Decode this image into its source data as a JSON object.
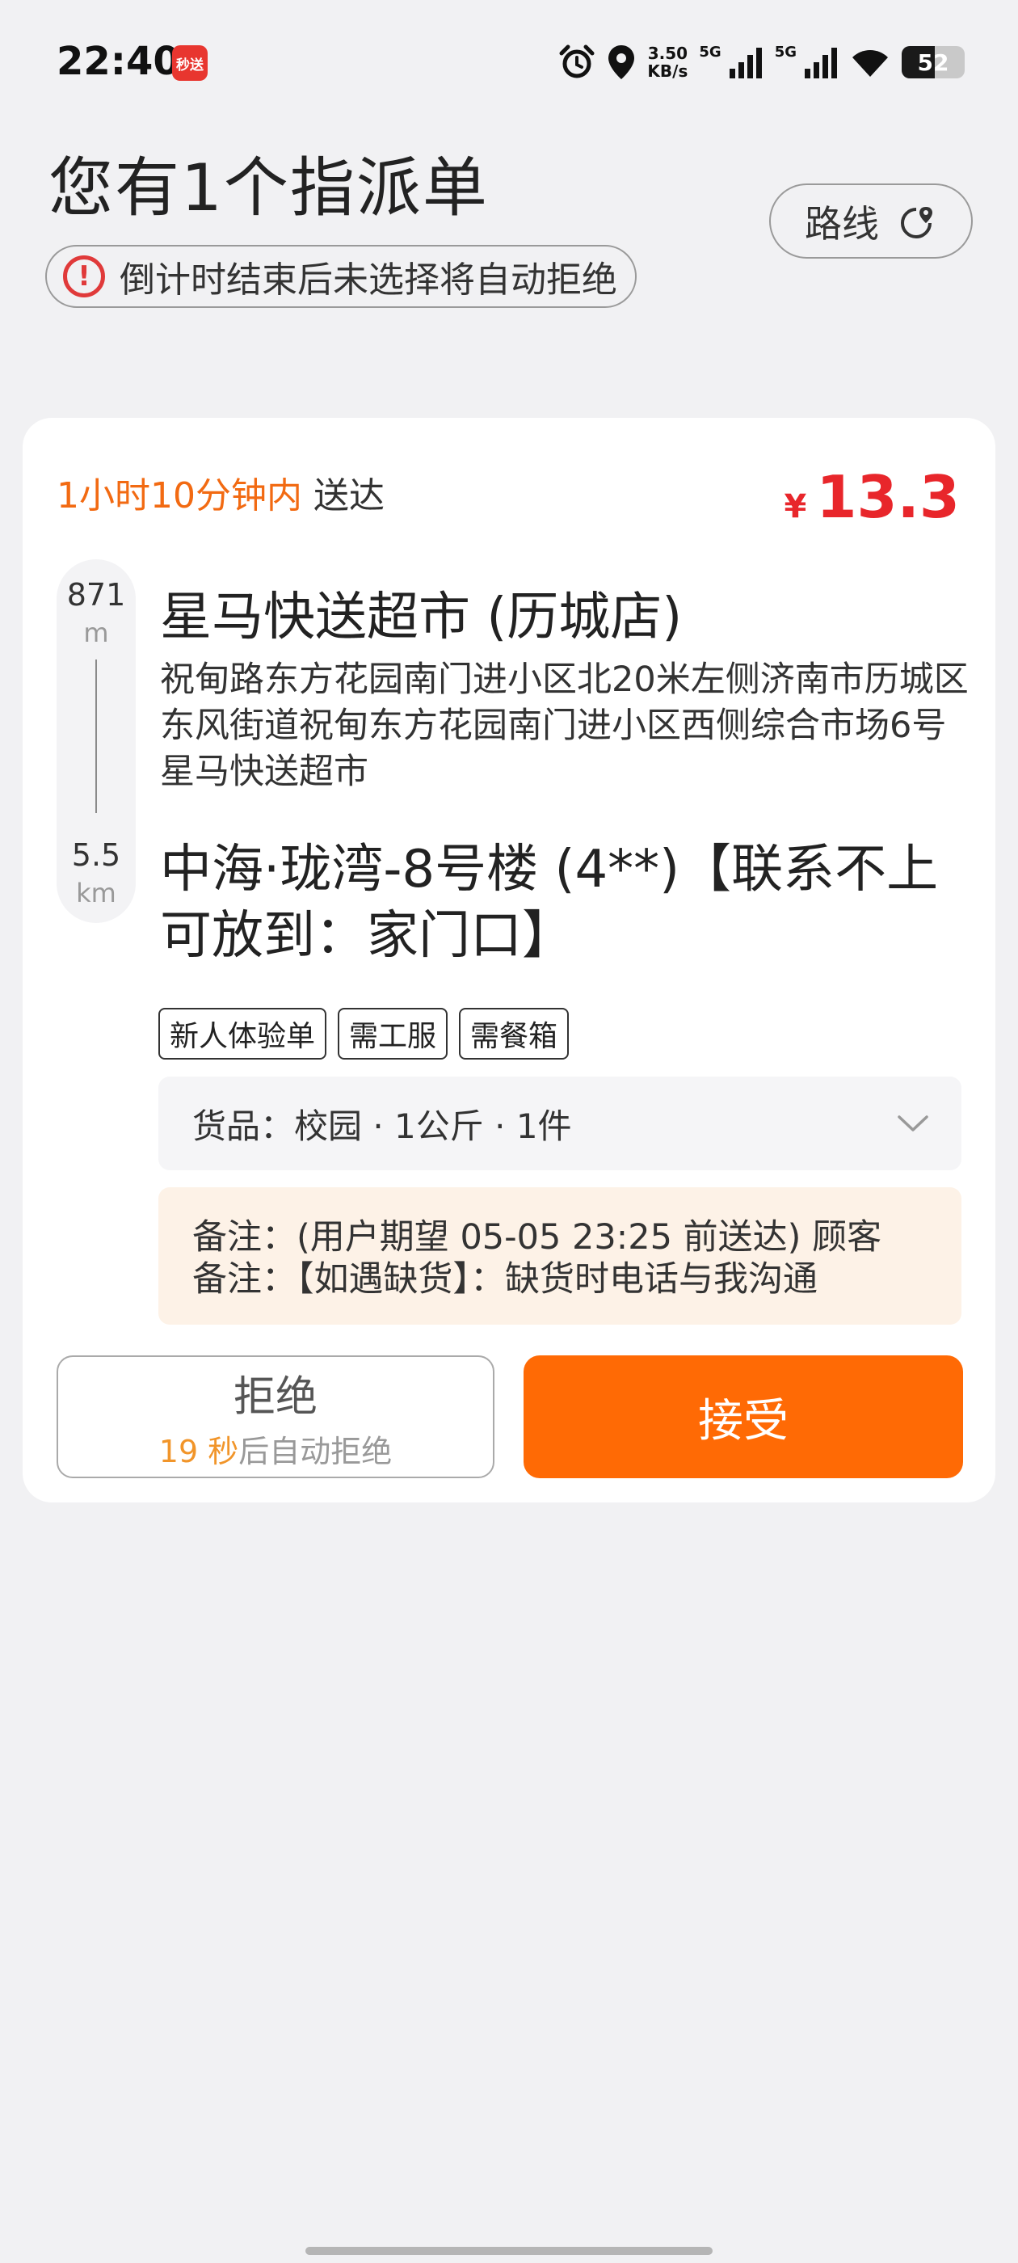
{
  "status_bar": {
    "time": "22:40",
    "app_badge": "秒送",
    "net_speed_value": "3.50",
    "net_speed_unit": "KB/s",
    "signal_1_label": "5G",
    "signal_2_label": "5G",
    "battery_level": "52",
    "battery_fraction": 0.52,
    "icons": [
      "alarm-icon",
      "location-icon",
      "signal-icon",
      "signal-icon",
      "wifi-icon",
      "battery-icon"
    ]
  },
  "header": {
    "title": "您有1个指派单",
    "warning": "倒计时结束后未选择将自动拒绝",
    "route_label": "路线"
  },
  "order": {
    "time_highlight": "1小时10分钟内",
    "time_suffix": "送达",
    "price_symbol": "¥",
    "price": "13.3",
    "pickup_distance": "871",
    "pickup_distance_unit": "m",
    "delivery_distance": "5.5",
    "delivery_distance_unit": "km",
    "store_name": "星马快送超市 (历城店)",
    "store_address": "祝甸路东方花园南门进小区北20米左侧济南市历城区东风街道祝甸东方花园南门进小区西侧综合市场6号星马快送超市",
    "destination": "中海·珑湾-8号楼 (4**)【联系不上可放到：家门口】",
    "tags": [
      "新人体验单",
      "需工服",
      "需餐箱"
    ],
    "goods": "货品：校园 · 1公斤 · 1件",
    "notes_line1": "备注：(用户期望 05-05 23:25 前送达) 顾客",
    "notes_line2": "备注：【如遇缺货】：缺货时电话与我沟通",
    "reject_label": "拒绝",
    "countdown_number": "19 秒",
    "countdown_suffix": "后自动拒绝",
    "accept_label": "接受"
  },
  "colors": {
    "accent_orange": "#ff6a05",
    "price_red": "#e8262b",
    "warning_red": "#e03a3a",
    "notes_bg": "#fdf2e7"
  }
}
